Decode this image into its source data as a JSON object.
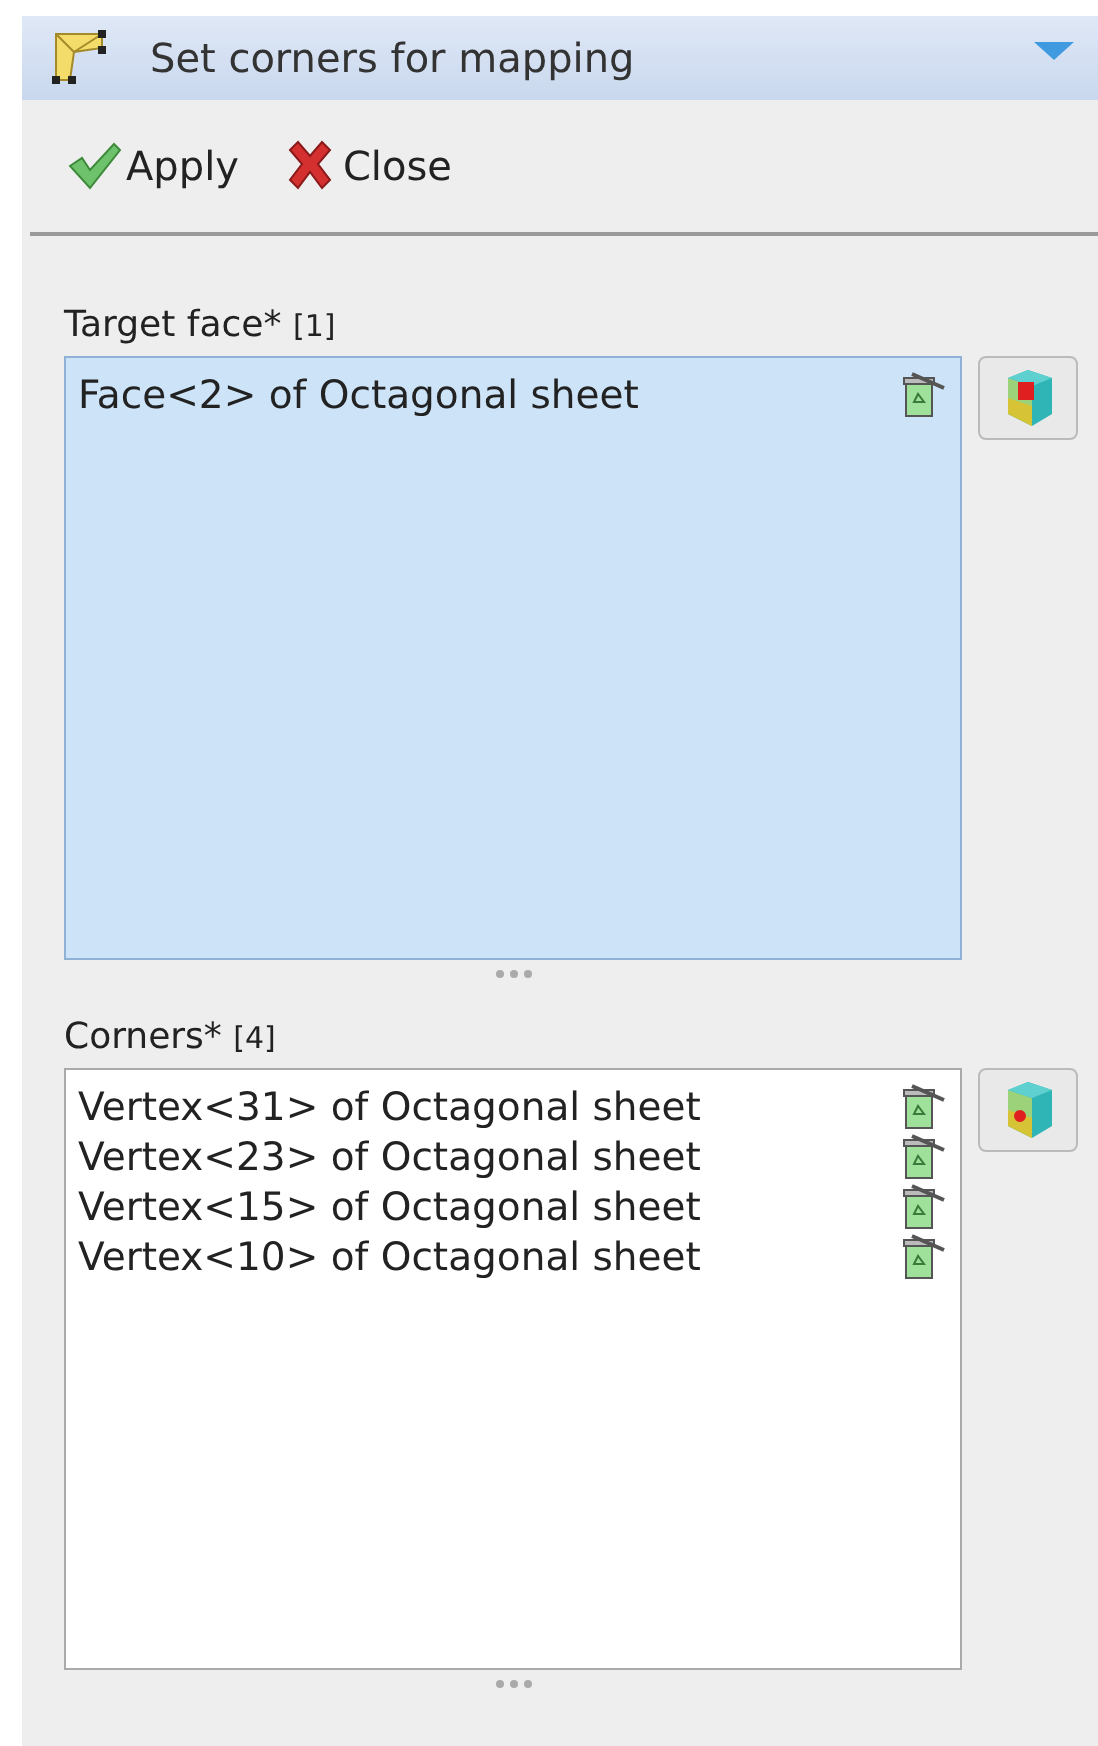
{
  "panel": {
    "title": "Set corners for mapping",
    "expanded": true
  },
  "toolbar": [
    {
      "kind": "apply",
      "label": "Apply"
    },
    {
      "kind": "close",
      "label": "Close"
    }
  ],
  "sections": [
    {
      "label": "Target face*",
      "count": "[1]",
      "active": true,
      "kind": "face",
      "items": [
        "Face<2> of Octagonal sheet"
      ]
    },
    {
      "label": "Corners*",
      "count": "[4]",
      "active": false,
      "kind": "vertex",
      "items": [
        "Vertex<31> of Octagonal sheet",
        "Vertex<23> of Octagonal sheet",
        "Vertex<15> of Octagonal sheet",
        "Vertex<10> of Octagonal sheet"
      ]
    }
  ]
}
